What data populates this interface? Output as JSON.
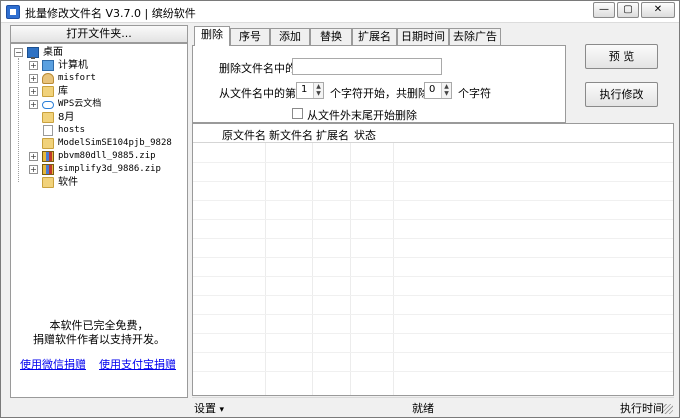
{
  "window": {
    "title": "批量修改文件名 V3.7.0 | 缤纷软件",
    "controls": {
      "minimize": "—",
      "maximize": "▢",
      "close": "✕"
    }
  },
  "left_panel": {
    "open_folder_label": "打开文件夹...",
    "tree": {
      "root": "桌面",
      "items": [
        {
          "label": "计算机",
          "icon": "computer-icon",
          "expandable": true,
          "mono": false
        },
        {
          "label": "misfort",
          "icon": "user-folder-icon",
          "expandable": true,
          "mono": true
        },
        {
          "label": "库",
          "icon": "library-folder-icon",
          "expandable": true,
          "mono": false
        },
        {
          "label": "WPS云文档",
          "icon": "cloud-icon",
          "expandable": true,
          "mono": false
        },
        {
          "label": "8月",
          "icon": "folder-icon",
          "expandable": false,
          "mono": false
        },
        {
          "label": "hosts",
          "icon": "file-icon",
          "expandable": false,
          "mono": true
        },
        {
          "label": "ModelSimSE104pjb_9828",
          "icon": "folder-icon",
          "expandable": false,
          "mono": true
        },
        {
          "label": "pbvm80dll_9885.zip",
          "icon": "zip-icon",
          "expandable": true,
          "mono": true
        },
        {
          "label": "simplify3d_9886.zip",
          "icon": "zip-icon",
          "expandable": true,
          "mono": true
        },
        {
          "label": "软件",
          "icon": "folder-icon",
          "expandable": false,
          "mono": false
        }
      ]
    },
    "free_notice_line1": "本软件已完全免费，",
    "free_notice_line2": "捐赠软件作者以支持开发。",
    "donate_wechat": "使用微信捐赠",
    "donate_alipay": "使用支付宝捐赠"
  },
  "tabs": [
    "删除",
    "序号",
    "添加",
    "替换",
    "扩展名",
    "日期时间",
    "去除广告"
  ],
  "delete_tab": {
    "delete_in_name_label": "删除文件名中的",
    "delete_in_name_value": "",
    "from_position_label": "从文件名中的第",
    "start_value": "1",
    "start_suffix": "个字符开始，共删除",
    "count_value": "0",
    "count_suffix": "个字符",
    "from_end_label": "从文件外末尾开始删除",
    "from_end_checked": false
  },
  "actions": {
    "preview": "预  览",
    "execute": "执行修改"
  },
  "file_list": {
    "columns": [
      "原文件名",
      "新文件名",
      "扩展名",
      "状态"
    ],
    "rows": []
  },
  "statusbar": {
    "settings": "设置",
    "settings_arrow": "▾",
    "status": "就绪",
    "exec_time": "执行时间"
  }
}
